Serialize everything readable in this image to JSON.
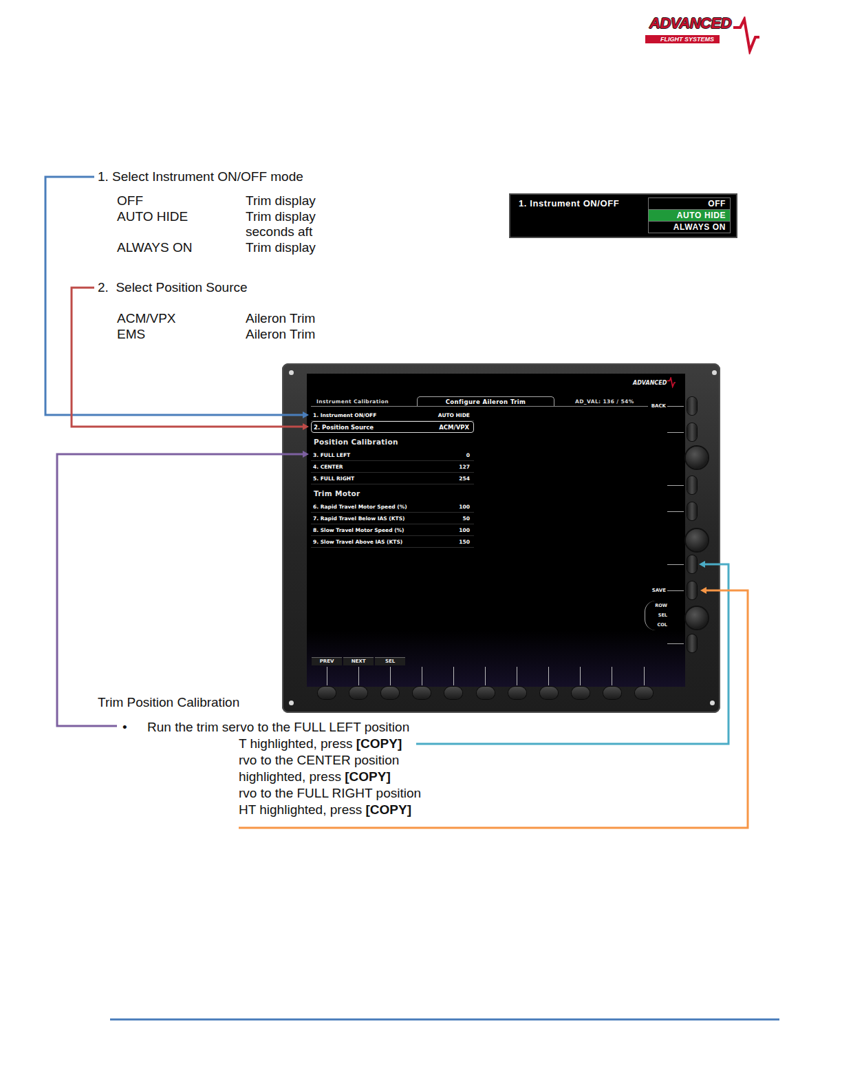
{
  "logo": {
    "name": "ADVANCED",
    "tagline": "FLIGHT SYSTEMS"
  },
  "step1": {
    "title": "1. Select Instrument ON/OFF mode",
    "options": [
      {
        "mode": "OFF",
        "lines": [
          "Trim display"
        ]
      },
      {
        "mode": "AUTO HIDE",
        "lines": [
          "Trim display",
          "seconds aft"
        ]
      },
      {
        "mode": "ALWAYS ON",
        "lines": [
          "Trim display"
        ]
      }
    ]
  },
  "dropdown": {
    "label": "1. Instrument ON/OFF",
    "options": [
      {
        "label": "OFF",
        "selected": false
      },
      {
        "label": "AUTO HIDE",
        "selected": true
      },
      {
        "label": "ALWAYS ON",
        "selected": false
      }
    ]
  },
  "step2": {
    "title": "2.  Select Position Source",
    "options": [
      {
        "mode": "ACM/VPX",
        "lines": [
          "Aileron Trim"
        ]
      },
      {
        "mode": "EMS",
        "lines": [
          "Aileron Trim"
        ]
      }
    ]
  },
  "display": {
    "logo": "ADVANCED",
    "tabs": [
      {
        "label": "Instrument Calibration",
        "selected": false
      },
      {
        "label": "Configure Aileron Trim",
        "selected": true
      }
    ],
    "ad_value": "AD_VAL: 136 / 54%",
    "rows": [
      {
        "kind": "row",
        "label": "1. Instrument ON/OFF",
        "value": "AUTO HIDE",
        "selected": false
      },
      {
        "kind": "row",
        "label": "2. Position Source",
        "value": "ACM/VPX",
        "selected": true
      },
      {
        "kind": "heading",
        "label": "Position Calibration",
        "value": "",
        "selected": false
      },
      {
        "kind": "row",
        "label": "3. FULL LEFT",
        "value": "0",
        "selected": false
      },
      {
        "kind": "row",
        "label": "4. CENTER",
        "value": "127",
        "selected": false
      },
      {
        "kind": "row",
        "label": "5. FULL RIGHT",
        "value": "254",
        "selected": false
      },
      {
        "kind": "heading",
        "label": "Trim Motor",
        "value": "",
        "selected": false
      },
      {
        "kind": "row",
        "label": "6. Rapid Travel Motor Speed (%)",
        "value": "100",
        "selected": false
      },
      {
        "kind": "row",
        "label": "7. Rapid Travel Below IAS (KTS)",
        "value": "50",
        "selected": false
      },
      {
        "kind": "row",
        "label": "8. Slow Travel Motor Speed (%)",
        "value": "100",
        "selected": false
      },
      {
        "kind": "row",
        "label": "9. Slow Travel Above IAS (KTS)",
        "value": "150",
        "selected": false
      }
    ],
    "side_controls": [
      {
        "kind": "button",
        "labels": [
          "BACK"
        ]
      },
      {
        "kind": "button",
        "labels": []
      },
      {
        "kind": "knob",
        "labels": []
      },
      {
        "kind": "button",
        "labels": []
      },
      {
        "kind": "button",
        "labels": []
      },
      {
        "kind": "knob",
        "labels": []
      },
      {
        "kind": "button",
        "labels": []
      },
      {
        "kind": "button",
        "labels": [
          "SAVE"
        ]
      },
      {
        "kind": "knob",
        "labels": [
          "ROW",
          "SEL",
          "COL"
        ]
      },
      {
        "kind": "button",
        "labels": []
      }
    ],
    "softkeys": [
      {
        "label": "PREV"
      },
      {
        "label": "NEXT"
      },
      {
        "label": "SEL"
      },
      {
        "label": ""
      },
      {
        "label": ""
      },
      {
        "label": ""
      },
      {
        "label": ""
      },
      {
        "label": ""
      },
      {
        "label": ""
      },
      {
        "label": ""
      },
      {
        "label": ""
      }
    ]
  },
  "calibration": {
    "title": "Trim Position Calibration",
    "bullet": "•",
    "first": "Run the trim servo to the FULL LEFT position",
    "lines": [
      {
        "text": "T highlighted, press ",
        "strong": "[COPY]"
      },
      {
        "text": "rvo to the CENTER position",
        "strong": ""
      },
      {
        "text": "highlighted, press ",
        "strong": "[COPY]"
      },
      {
        "text": "rvo to the FULL RIGHT position",
        "strong": ""
      },
      {
        "text": "HT highlighted, press ",
        "strong": "[COPY]"
      }
    ]
  },
  "connectors": [
    {
      "target": "instrument-on-off",
      "color": "#4a7ebb"
    },
    {
      "target": "position-source",
      "color": "#be4b48"
    },
    {
      "target": "position-calibration",
      "color": "#7d60a0"
    },
    {
      "target": "copy-button",
      "color": "#4bacc6"
    },
    {
      "target": "save-button",
      "color": "#f79646"
    }
  ]
}
